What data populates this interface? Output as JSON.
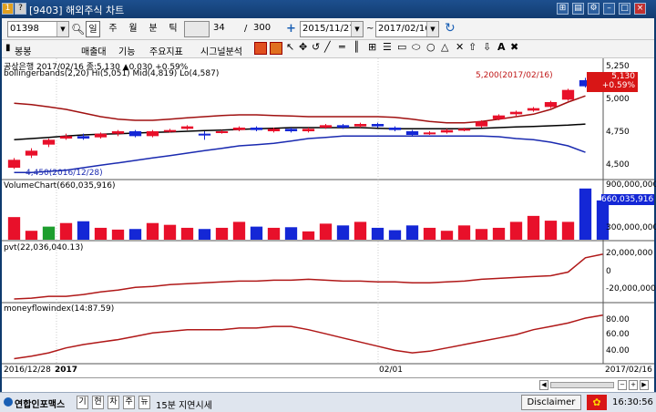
{
  "window": {
    "badge": "1",
    "help": "?",
    "title": "[9403] 해외주식 차트"
  },
  "toolbar": {
    "code": "01398",
    "periods": [
      "일",
      "주",
      "월",
      "분",
      "틱"
    ],
    "count_value": "34",
    "slash": "/",
    "count_total": "300",
    "date_from": "2015/11/27",
    "tilde": "~",
    "date_to": "2017/02/16"
  },
  "toolbar2": {
    "items": [
      "봉봉",
      "매출대",
      "기능",
      "주요지표",
      "시그널분석"
    ]
  },
  "chart": {
    "instrument_label": "공상은행  2017/02/16 종:5,130 ▲0.030 +0.59%",
    "bb_label": "bollingerbands(2,20) Hi(5,051) Mid(4,819) Lo(4,587)",
    "high_annotation": "5,200(2017/02/16)",
    "low_annotation": "4,450(2016/12/28)",
    "price_box": [
      "5,130",
      "+0.59%"
    ],
    "price_axis": [
      "5,250",
      "5,000",
      "4,750",
      "4,500"
    ],
    "volume_label": "VolumeChart(660,035,916)",
    "volume_box": "660,035,916",
    "volume_axis": [
      "900,000,000",
      "300,000,000"
    ],
    "pvt_label": "pvt(22,036,040.13)",
    "pvt_axis": [
      "20,000,000",
      "0",
      "-20,000,000"
    ],
    "mfi_label": "moneyflowindex(14:87.59)",
    "mfi_axis": [
      "80.00",
      "60.00",
      "40.00"
    ],
    "date_axis": [
      "2016/12/28",
      "2017",
      "02/01",
      "2017/02/16"
    ]
  },
  "chart_data": {
    "type": "candlestick",
    "dates_range": [
      "2016/12/28",
      "2017/02/16"
    ],
    "candles": [
      {
        "o": 4460,
        "c": 4525,
        "h": 4540,
        "l": 4450,
        "up": true
      },
      {
        "o": 4560,
        "c": 4600,
        "h": 4620,
        "l": 4540,
        "up": true
      },
      {
        "o": 4650,
        "c": 4690,
        "h": 4700,
        "l": 4630,
        "up": true
      },
      {
        "o": 4700,
        "c": 4720,
        "h": 4740,
        "l": 4690,
        "up": true
      },
      {
        "o": 4720,
        "c": 4700,
        "h": 4740,
        "l": 4690,
        "up": false
      },
      {
        "o": 4710,
        "c": 4740,
        "h": 4750,
        "l": 4700,
        "up": true
      },
      {
        "o": 4740,
        "c": 4760,
        "h": 4770,
        "l": 4720,
        "up": true
      },
      {
        "o": 4760,
        "c": 4720,
        "h": 4770,
        "l": 4710,
        "up": false
      },
      {
        "o": 4720,
        "c": 4760,
        "h": 4770,
        "l": 4710,
        "up": true
      },
      {
        "o": 4760,
        "c": 4770,
        "h": 4780,
        "l": 4750,
        "up": true
      },
      {
        "o": 4780,
        "c": 4800,
        "h": 4810,
        "l": 4770,
        "up": true
      },
      {
        "o": 4740,
        "c": 4740,
        "h": 4760,
        "l": 4690,
        "up": false
      },
      {
        "o": 4750,
        "c": 4760,
        "h": 4770,
        "l": 4740,
        "up": true
      },
      {
        "o": 4770,
        "c": 4790,
        "h": 4800,
        "l": 4760,
        "up": true
      },
      {
        "o": 4790,
        "c": 4770,
        "h": 4800,
        "l": 4760,
        "up": false
      },
      {
        "o": 4760,
        "c": 4780,
        "h": 4790,
        "l": 4750,
        "up": true
      },
      {
        "o": 4780,
        "c": 4760,
        "h": 4790,
        "l": 4750,
        "up": false
      },
      {
        "o": 4760,
        "c": 4780,
        "h": 4790,
        "l": 4750,
        "up": true
      },
      {
        "o": 4790,
        "c": 4810,
        "h": 4820,
        "l": 4780,
        "up": true
      },
      {
        "o": 4810,
        "c": 4790,
        "h": 4820,
        "l": 4780,
        "up": false
      },
      {
        "o": 4800,
        "c": 4820,
        "h": 4830,
        "l": 4790,
        "up": true
      },
      {
        "o": 4820,
        "c": 4800,
        "h": 4830,
        "l": 4790,
        "up": false
      },
      {
        "o": 4790,
        "c": 4770,
        "h": 4800,
        "l": 4760,
        "up": false
      },
      {
        "o": 4760,
        "c": 4730,
        "h": 4770,
        "l": 4720,
        "up": false
      },
      {
        "o": 4740,
        "c": 4750,
        "h": 4760,
        "l": 4730,
        "up": true
      },
      {
        "o": 4750,
        "c": 4770,
        "h": 4780,
        "l": 4740,
        "up": true
      },
      {
        "o": 4770,
        "c": 4780,
        "h": 4790,
        "l": 4760,
        "up": true
      },
      {
        "o": 4800,
        "c": 4840,
        "h": 4850,
        "l": 4790,
        "up": true
      },
      {
        "o": 4860,
        "c": 4890,
        "h": 4900,
        "l": 4850,
        "up": true
      },
      {
        "o": 4900,
        "c": 4920,
        "h": 4930,
        "l": 4880,
        "up": true
      },
      {
        "o": 4930,
        "c": 4950,
        "h": 4960,
        "l": 4920,
        "up": true
      },
      {
        "o": 4960,
        "c": 5000,
        "h": 5010,
        "l": 4950,
        "up": true
      },
      {
        "o": 5020,
        "c": 5100,
        "h": 5110,
        "l": 5010,
        "up": true
      },
      {
        "o": 5130,
        "c": 5180,
        "h": 5200,
        "l": 5120,
        "up": false
      }
    ],
    "bb_hi": [
      4990,
      4980,
      4960,
      4940,
      4910,
      4880,
      4860,
      4850,
      4850,
      4860,
      4870,
      4880,
      4890,
      4895,
      4895,
      4890,
      4885,
      4880,
      4880,
      4880,
      4880,
      4880,
      4875,
      4860,
      4840,
      4830,
      4830,
      4840,
      4860,
      4880,
      4900,
      4940,
      5000,
      5051
    ],
    "bb_mid": [
      4690,
      4700,
      4710,
      4720,
      4730,
      4735,
      4740,
      4745,
      4750,
      4755,
      4760,
      4765,
      4770,
      4775,
      4780,
      4785,
      4790,
      4790,
      4790,
      4790,
      4790,
      4785,
      4780,
      4780,
      4780,
      4780,
      4780,
      4785,
      4790,
      4795,
      4800,
      4805,
      4810,
      4819
    ],
    "bb_lo": [
      4420,
      4420,
      4430,
      4440,
      4460,
      4480,
      4500,
      4520,
      4540,
      4560,
      4580,
      4600,
      4620,
      4640,
      4650,
      4660,
      4680,
      4700,
      4710,
      4720,
      4720,
      4720,
      4720,
      4720,
      4720,
      4720,
      4720,
      4720,
      4715,
      4700,
      4690,
      4670,
      4640,
      4587
    ],
    "volume": [
      380,
      150,
      220,
      280,
      310,
      200,
      170,
      180,
      280,
      250,
      200,
      180,
      200,
      300,
      220,
      200,
      210,
      140,
      270,
      240,
      300,
      200,
      160,
      240,
      200,
      150,
      240,
      180,
      200,
      300,
      400,
      320,
      300,
      860,
      660
    ],
    "pvt": [
      -28,
      -27,
      -25,
      -25,
      -23,
      -20,
      -18,
      -15,
      -14,
      -12,
      -11,
      -10,
      -9,
      -8,
      -8,
      -7,
      -7,
      -6,
      -7,
      -8,
      -8,
      -9,
      -9,
      -10,
      -10,
      -9,
      -8,
      -6,
      -5,
      -4,
      -3,
      -2,
      2,
      18,
      22
    ],
    "mfi": [
      35,
      38,
      42,
      48,
      52,
      55,
      58,
      62,
      66,
      68,
      70,
      70,
      70,
      72,
      72,
      74,
      74,
      70,
      65,
      60,
      55,
      50,
      45,
      42,
      44,
      48,
      52,
      56,
      60,
      64,
      70,
      74,
      78,
      84,
      87.59
    ],
    "price_range": [
      4400,
      5300
    ],
    "volume_max": 900000000,
    "pvt_range": [
      -30000000,
      30000000
    ],
    "mfi_range": [
      30,
      95
    ],
    "colors": {
      "up": "#e8102a",
      "down": "#1427d6",
      "neutral": "#1e9e2e",
      "bb_hi": "#a01010",
      "bb_mid": "#000000",
      "bb_lo": "#1a2ab0",
      "line": "#b01818"
    }
  },
  "status": {
    "logo": "연합인포맥스",
    "buttons": [
      "기",
      "현",
      "차",
      "주",
      "뉴"
    ],
    "delay": "15분 지연시세",
    "disclaimer": "Disclaimer",
    "time": "16:30:56"
  }
}
